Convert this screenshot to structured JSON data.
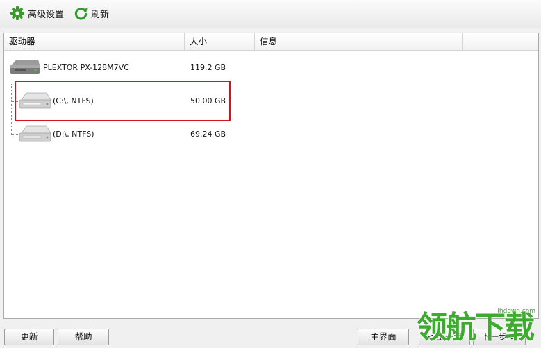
{
  "toolbar": {
    "advanced_settings": "高级设置",
    "refresh": "刷新"
  },
  "table": {
    "headers": [
      "驱动器",
      "大小",
      "信息"
    ],
    "rows": [
      {
        "name": "PLEXTOR PX-128M7VC",
        "size": "119.2 GB",
        "info": ""
      },
      {
        "name": "(C:\\, NTFS)",
        "size": "50.00 GB",
        "info": ""
      },
      {
        "name": "(D:\\, NTFS)",
        "size": "69.24 GB",
        "info": ""
      }
    ]
  },
  "buttons": {
    "update": "更新",
    "help": "帮助",
    "main": "主界面",
    "prev": "< 上一步",
    "next": "下一步 >"
  },
  "watermark": {
    "text": "领航下载",
    "url": "lhdown.com"
  },
  "colors": {
    "gear": "#3a9a2a",
    "refresh": "#2f9a2a",
    "highlight": "#d0141c",
    "watermark": "#3cab2e"
  }
}
